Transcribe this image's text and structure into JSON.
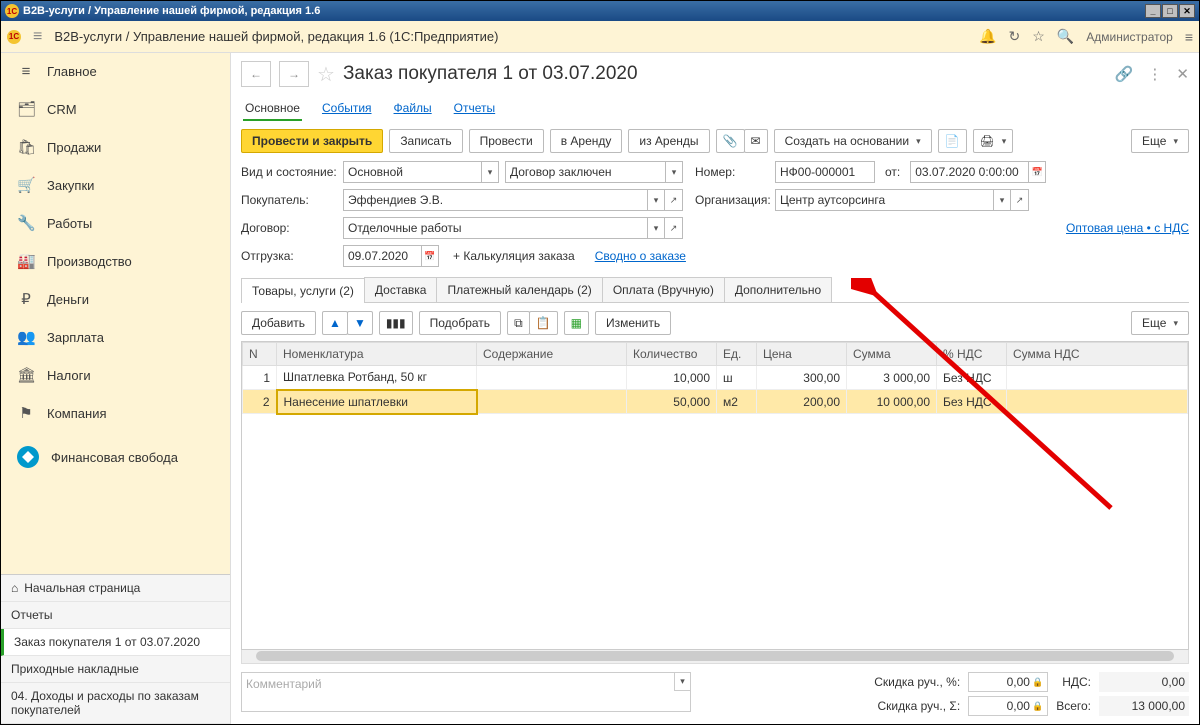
{
  "window": {
    "title": "В2В-услуги / Управление нашей фирмой, редакция 1.6"
  },
  "appbar": {
    "breadcrumb": "В2В-услуги / Управление нашей фирмой, редакция 1.6  (1С:Предприятие)",
    "user": "Администратор"
  },
  "sidebar": {
    "items": [
      {
        "label": "Главное"
      },
      {
        "label": "CRM"
      },
      {
        "label": "Продажи"
      },
      {
        "label": "Закупки"
      },
      {
        "label": "Работы"
      },
      {
        "label": "Производство"
      },
      {
        "label": "Деньги"
      },
      {
        "label": "Зарплата"
      },
      {
        "label": "Налоги"
      },
      {
        "label": "Компания"
      },
      {
        "label": "Финансовая свобода"
      }
    ],
    "bottom": [
      {
        "label": "Начальная страница"
      },
      {
        "label": "Отчеты"
      },
      {
        "label": "Заказ покупателя 1 от 03.07.2020"
      },
      {
        "label": "Приходные накладные"
      },
      {
        "label": "04. Доходы и расходы по заказам покупателей"
      }
    ]
  },
  "doc": {
    "title": "Заказ покупателя 1 от 03.07.2020",
    "subtabs": [
      "Основное",
      "События",
      "Файлы",
      "Отчеты"
    ],
    "toolbar": {
      "post_close": "Провести и закрыть",
      "save": "Записать",
      "post": "Провести",
      "to_rent": "в Аренду",
      "from_rent": "из Аренды",
      "create_based": "Создать на основании",
      "more": "Еще"
    },
    "fields": {
      "kind_state_label": "Вид и состояние:",
      "kind": "Основной",
      "state": "Договор заключен",
      "number_label": "Номер:",
      "number": "НФ00-000001",
      "from_label": "от:",
      "date": "03.07.2020  0:00:00",
      "buyer_label": "Покупатель:",
      "buyer": "Эффендиев Э.В.",
      "org_label": "Организация:",
      "org": "Центр аутсорсинга",
      "contract_label": "Договор:",
      "contract": "Отделочные работы",
      "price_link": "Оптовая цена • с НДС",
      "ship_label": "Отгрузка:",
      "ship_date": "09.07.2020",
      "calc_label": "+ Калькуляция заказа",
      "summary_link": "Сводно о заказе"
    },
    "grid_tabs": [
      "Товары, услуги (2)",
      "Доставка",
      "Платежный календарь (2)",
      "Оплата (Вручную)",
      "Дополнительно"
    ],
    "grid_toolbar": {
      "add": "Добавить",
      "pick": "Подобрать",
      "edit": "Изменить",
      "more": "Еще"
    },
    "columns": [
      "N",
      "Номенклатура",
      "Содержание",
      "Количество",
      "Ед.",
      "Цена",
      "Сумма",
      "% НДС",
      "Сумма НДС"
    ],
    "rows": [
      {
        "n": "1",
        "item": "Шпатлевка Ротбанд, 50 кг",
        "content": "",
        "qty": "10,000",
        "unit": "ш",
        "price": "300,00",
        "sum": "3 000,00",
        "vat": "Без НДС",
        "vat_sum": ""
      },
      {
        "n": "2",
        "item": "Нанесение шпатлевки",
        "content": "",
        "qty": "50,000",
        "unit": "м2",
        "price": "200,00",
        "sum": "10 000,00",
        "vat": "Без НДС",
        "vat_sum": ""
      }
    ],
    "footer": {
      "comment_ph": "Комментарий",
      "disc_pct_label": "Скидка руч., %:",
      "disc_pct": "0,00",
      "disc_sum_label": "Скидка руч., Σ:",
      "disc_sum": "0,00",
      "vat_label": "НДС:",
      "vat": "0,00",
      "total_label": "Всего:",
      "total": "13 000,00"
    }
  }
}
